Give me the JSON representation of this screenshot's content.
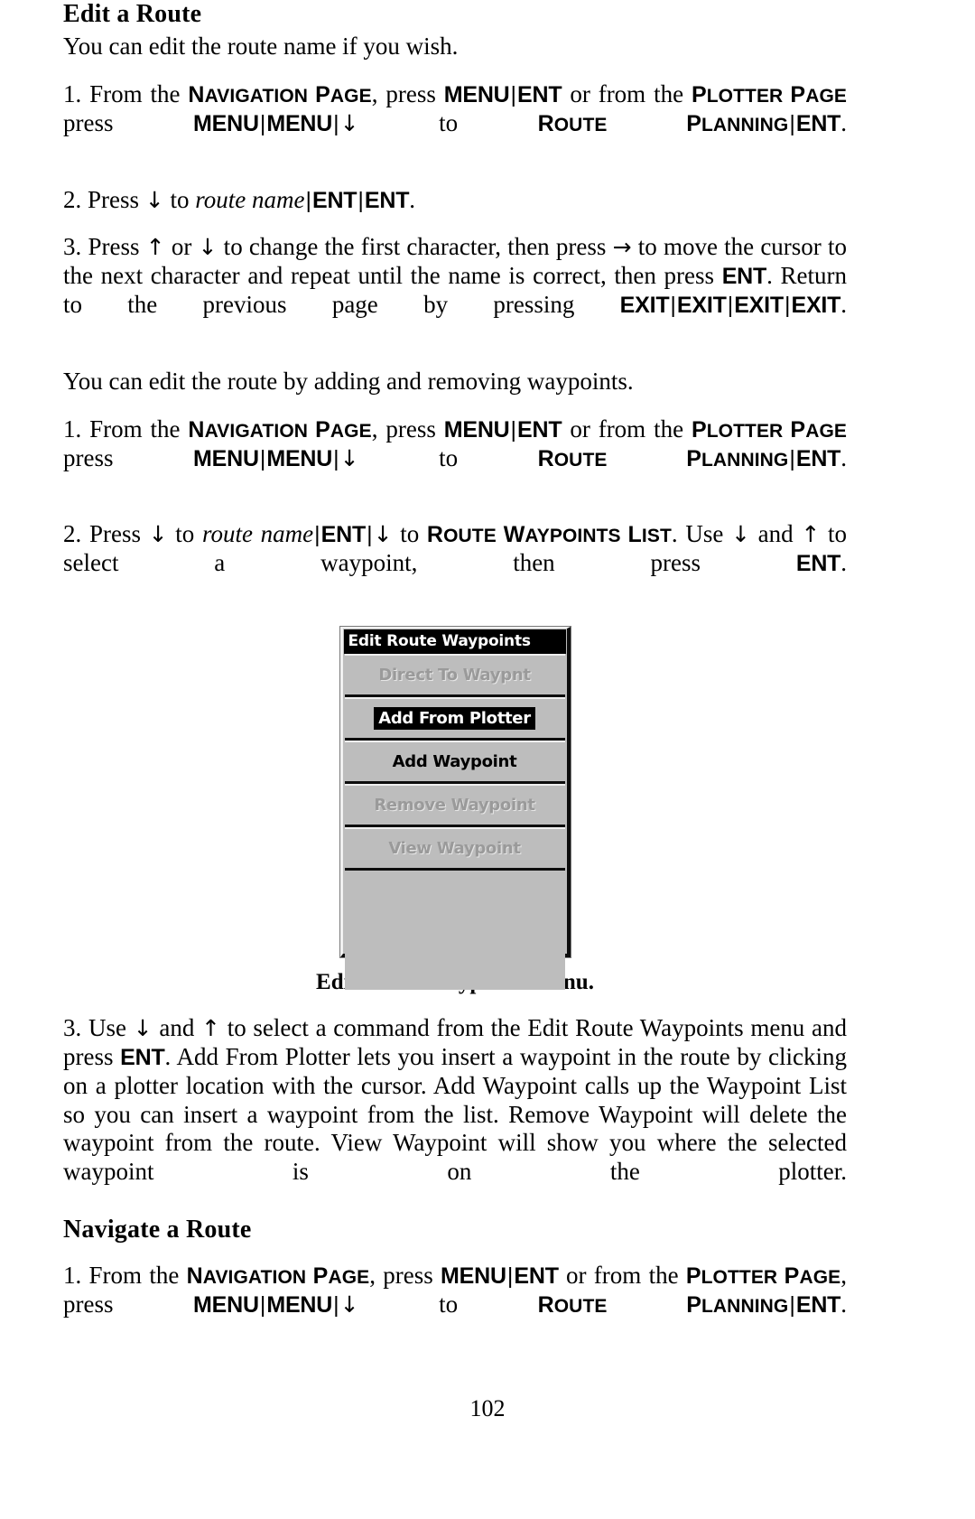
{
  "document": {
    "page_number": "102"
  },
  "sections": {
    "edit_route": {
      "heading": "Edit a Route",
      "lead": "You can edit the route name if you wish.",
      "step1": {
        "number": "1.",
        "t1": "From the ",
        "nav_page": "Navigation Page",
        "t2": ", press ",
        "key_menu": "MENU",
        "sep1": "|",
        "key_ent": "ENT",
        "t3": " or from the ",
        "plotter_page": "Plotter Page",
        "t4": " press ",
        "key_menu2": "MENU",
        "sep2": "|",
        "key_menu3": "MENU",
        "sep3": "|",
        "arrow_down": "↓",
        "t5": " to ",
        "route_planning": "Route Planning",
        "sep4": "|",
        "key_ent2": "ENT",
        "t6": "."
      },
      "step2": {
        "number": "2.",
        "t1": "Press ",
        "arrow_down": "↓",
        "t2": " to ",
        "route_name": "route name",
        "sep1": "|",
        "key_ent": "ENT",
        "sep2": "|",
        "key_ent2": "ENT",
        "t3": "."
      },
      "step3": {
        "number": "3.",
        "t1": "Press ",
        "arrow_up": "↑",
        "t2": " or ",
        "arrow_down": "↓",
        "t3": " to change the first character, then press ",
        "arrow_right": "→",
        "t4": " to move the cursor to the next character and repeat until the name is correct, then press ",
        "key_ent": "ENT",
        "t5": ". Return to the previous page by pressing ",
        "key_exit1": "EXIT",
        "sep1": "|",
        "key_exit2": "EXIT",
        "sep2": "|",
        "key_exit3": "EXIT",
        "sep3": "|",
        "key_exit4": "EXIT",
        "t6": "."
      }
    },
    "edit_waypoints": {
      "lead": "You can edit the route by adding and removing waypoints.",
      "step1": {
        "number": "1.",
        "t1": "From the ",
        "nav_page": "Navigation Page",
        "t2": ", press ",
        "key_menu": "MENU",
        "sep1": "|",
        "key_ent": "ENT",
        "t3": " or from the ",
        "plotter_page": "Plotter Page",
        "t4": " press ",
        "key_menu2": "MENU",
        "sep2": "|",
        "key_menu3": "MENU",
        "sep3": "|",
        "arrow_down": "↓",
        "t5": " to ",
        "route_planning": "Route Planning",
        "sep4": "|",
        "key_ent2": "ENT",
        "t6": "."
      },
      "step2": {
        "number": "2.",
        "t1": "Press ",
        "arrow_down": "↓",
        "t2": " to ",
        "route_name": "route name",
        "sep1": "|",
        "key_ent": "ENT",
        "sep2": "|",
        "arrow_down2": "↓",
        "t3": " to ",
        "route_wp_list": "Route Waypoints List",
        "t4": ". Use ",
        "arrow_down3": "↓",
        "t5": " and ",
        "arrow_up": "↑",
        "t6": " to select a waypoint, then press ",
        "key_ent2": "ENT",
        "t7": "."
      },
      "step3": {
        "number": "3.",
        "t1": "Use ",
        "arrow_down": "↓",
        "t2": " and ",
        "arrow_up": "↑",
        "t3": " to select a command from the Edit Route Waypoints menu and press ",
        "key_ent": "ENT",
        "t4": ". Add From Plotter lets you insert a waypoint in the route by clicking on a plotter location with the cursor. Add Waypoint calls up the Waypoint List so you can insert a waypoint from the list. Remove Waypoint will delete the waypoint from the route. View Waypoint will show you where the selected waypoint is on the plotter."
      }
    },
    "navigate_route": {
      "heading": "Navigate a Route",
      "step1": {
        "number": "1.",
        "t1": "From the ",
        "nav_page": "Navigation Page",
        "t2": ", press ",
        "key_menu": "MENU",
        "sep1": "|",
        "key_ent": "ENT",
        "t3": " or from the ",
        "plotter_page": "Plotter Page",
        "t4": ", press ",
        "key_menu2": "MENU",
        "sep2": "|",
        "key_menu3": "MENU",
        "sep3": "|",
        "arrow_down": "↓",
        "t5": " to ",
        "route_planning": "Route Planning",
        "sep4": "|",
        "key_ent2": "ENT",
        "t6": "."
      }
    }
  },
  "figure": {
    "caption": "Edit Route Waypoints menu.",
    "device_menu": {
      "title": "Edit Route Waypoints",
      "items": [
        {
          "label": "Direct To Waypnt",
          "state": "disabled"
        },
        {
          "label": "Add From Plotter",
          "state": "selected"
        },
        {
          "label": "Add Waypoint",
          "state": "enabled"
        },
        {
          "label": "Remove Waypoint",
          "state": "disabled"
        },
        {
          "label": "View Waypoint",
          "state": "disabled"
        }
      ]
    }
  },
  "colors": {
    "device_background": "#bdbdbd",
    "device_titlebar": "#000000",
    "device_title_text": "#ffffff",
    "disabled_text": "#9a9a9a",
    "page_background": "#ffffff",
    "body_text": "#000000"
  }
}
